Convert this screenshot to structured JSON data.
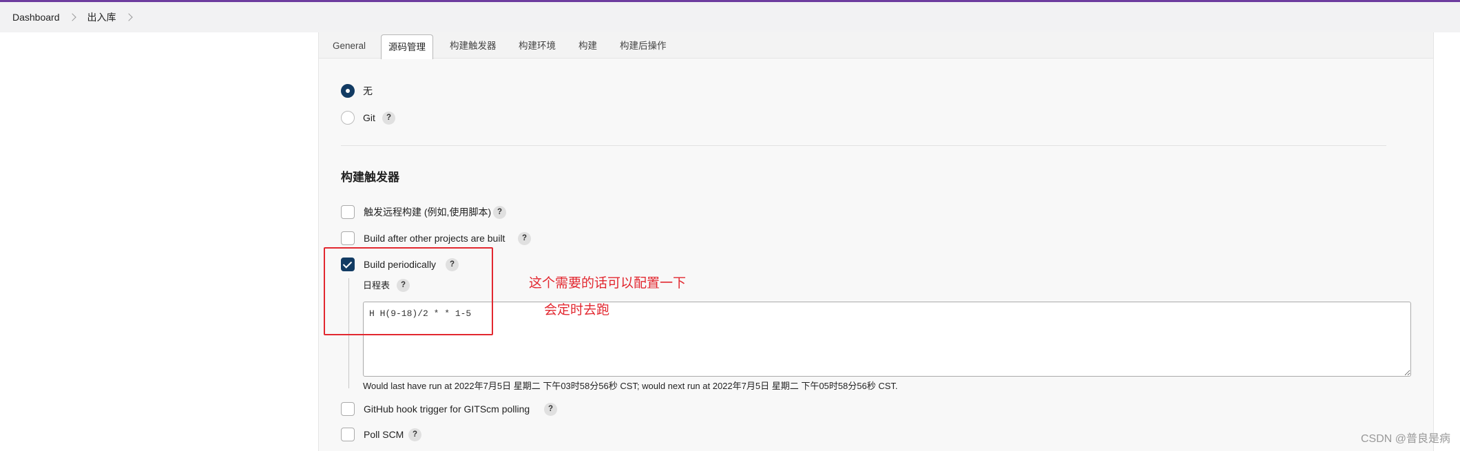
{
  "breadcrumbs": [
    {
      "label": "Dashboard"
    },
    {
      "label": "出入库"
    }
  ],
  "tabs": [
    {
      "label": "General"
    },
    {
      "label": "源码管理"
    },
    {
      "label": "构建触发器"
    },
    {
      "label": "构建环境"
    },
    {
      "label": "构建"
    },
    {
      "label": "构建后操作"
    }
  ],
  "active_tab": "源码管理",
  "scm": {
    "options": [
      {
        "label": "无",
        "selected": true
      },
      {
        "label": "Git",
        "selected": false
      }
    ]
  },
  "triggers": {
    "title": "构建触发器",
    "items": [
      {
        "label": "触发远程构建 (例如,使用脚本)",
        "checked": false
      },
      {
        "label": "Build after other projects are built",
        "checked": false
      },
      {
        "label": "Build periodically",
        "checked": true
      },
      {
        "label": "GitHub hook trigger for GITScm polling",
        "checked": false
      },
      {
        "label": "Poll SCM",
        "checked": false
      }
    ],
    "schedule_label": "日程表",
    "schedule_value": "H H(9-18)/2 * * 1-5",
    "schedule_hint": "Would last have run at 2022年7月5日 星期二 下午03时58分56秒 CST; would next run at 2022年7月5日 星期二 下午05时58分56秒 CST."
  },
  "help_glyph": "?",
  "annotation": {
    "line1": "这个需要的话可以配置一下",
    "line2": "会定时去跑",
    "color": "#e2272f"
  },
  "watermark": "CSDN @普良是病",
  "colors": {
    "accent": "#123b63",
    "topbar": "#6d3c9e"
  }
}
